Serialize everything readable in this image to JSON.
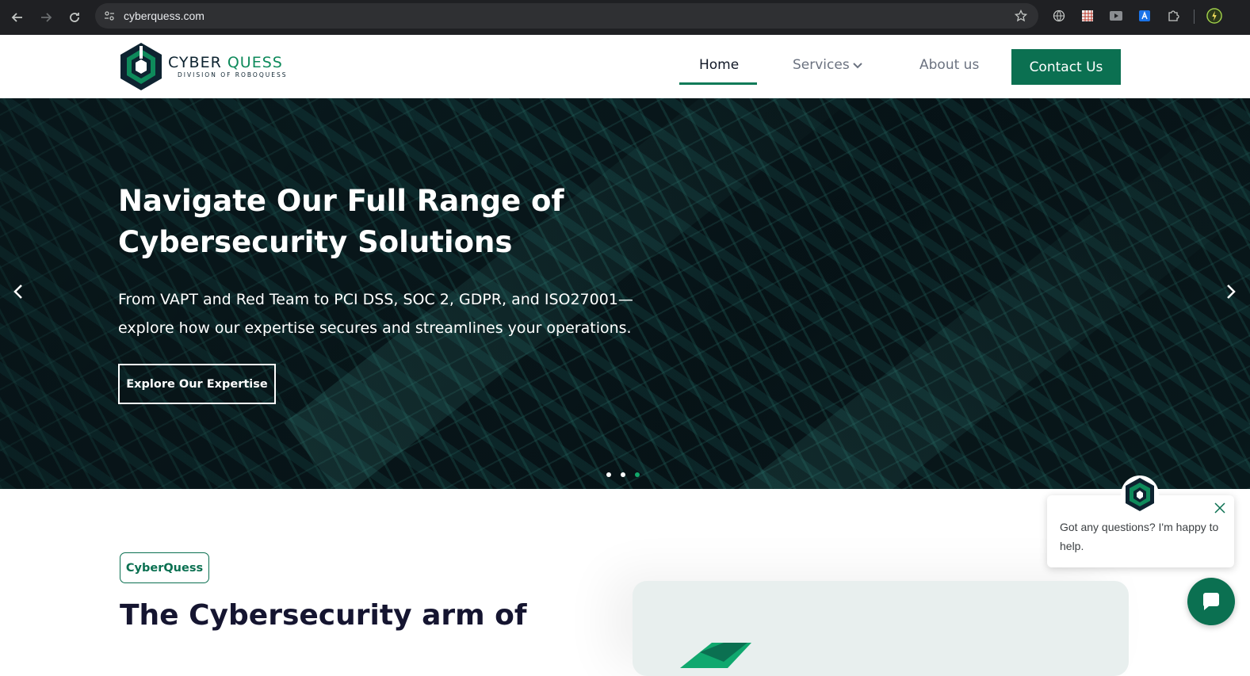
{
  "browser": {
    "url": "cyberquess.com",
    "icons": [
      "back-icon",
      "forward-icon",
      "reload-icon",
      "site-settings-icon",
      "bookmark-star-icon",
      "globe-icon",
      "extension-grid-icon",
      "video-extension-icon",
      "translate-extension-icon",
      "extensions-puzzle-icon",
      "profile-avatar-icon"
    ]
  },
  "header": {
    "logo_name_part1": "CYBER",
    "logo_name_part2": "QUESS",
    "logo_subtitle": "DIVISION OF ROBOQUESS",
    "nav": {
      "home": "Home",
      "services": "Services",
      "about": "About us",
      "contact": "Contact Us"
    }
  },
  "hero": {
    "title_line1": "Navigate Our Full Range of",
    "title_line2": "Cybersecurity Solutions",
    "text_line1": "From VAPT and Red Team to PCI DSS, SOC 2, GDPR, and ISO27001—",
    "text_line2": "explore how our expertise secures and streamlines your operations.",
    "button": "Explore Our Expertise",
    "slides_total": 3,
    "active_slide": 3
  },
  "intro": {
    "tag": "CyberQuess",
    "title": "The Cybersecurity arm of"
  },
  "chat": {
    "message": "Got any questions? I'm happy to help."
  },
  "colors": {
    "brand_green": "#0b7051",
    "brand_dark": "#0d2330",
    "active_dot": "#12a86a"
  }
}
